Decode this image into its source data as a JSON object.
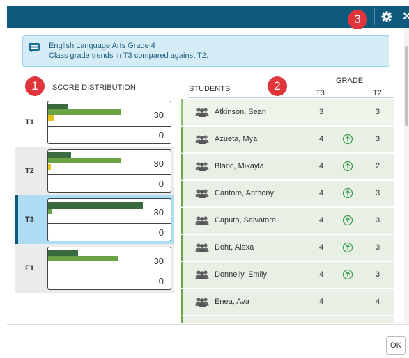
{
  "callouts": [
    "1",
    "2",
    "3"
  ],
  "info": {
    "line1": "English Language Arts Grade 4",
    "line2": "Class grade trends in T3 compared against T2."
  },
  "score_distribution": {
    "header": "SCORE DISTRIBUTION",
    "terms": [
      {
        "label": "T1",
        "top_count": "30",
        "bottom_count": "0",
        "bars": {
          "dark_fraction": 0.27,
          "green_fraction": 0.98,
          "yellow_fraction": 0.08
        }
      },
      {
        "label": "T2",
        "top_count": "30",
        "bottom_count": "0",
        "bars": {
          "dark_fraction": 0.32,
          "green_fraction": 1.0,
          "yellow_fraction": 0.04
        }
      },
      {
        "label": "T3",
        "top_count": "30",
        "bottom_count": "0",
        "selected": true,
        "bars": {
          "green_fraction": 1.0,
          "dark_fraction": 0.04
        }
      },
      {
        "label": "F1",
        "top_count": "30",
        "bottom_count": "0",
        "bars": {
          "dark_fraction": 0.43,
          "green_fraction": 1.0
        }
      }
    ]
  },
  "students": {
    "header": "STUDENTS",
    "grade_header": "GRADE",
    "col_t3": "T3",
    "col_t2": "T2",
    "rows": [
      {
        "name": "Atkinson, Sean",
        "t3": "3",
        "t2": "3",
        "trend": ""
      },
      {
        "name": "Azueta, Mya",
        "t3": "4",
        "t2": "3",
        "trend": "up"
      },
      {
        "name": "Blanc, Mikayla",
        "t3": "4",
        "t2": "2",
        "trend": "up"
      },
      {
        "name": "Cantore, Anthony",
        "t3": "4",
        "t2": "3",
        "trend": "up"
      },
      {
        "name": "Caputo, Salvatore",
        "t3": "4",
        "t2": "3",
        "trend": "up"
      },
      {
        "name": "Doht, Alexa",
        "t3": "4",
        "t2": "3",
        "trend": "up"
      },
      {
        "name": "Donnelly, Emily",
        "t3": "4",
        "t2": "3",
        "trend": "up"
      },
      {
        "name": "Enea, Ava",
        "t3": "4",
        "t2": "4",
        "trend": ""
      },
      {
        "name": "",
        "t3": "",
        "t2": "",
        "trend": ""
      }
    ]
  },
  "buttons": {
    "ok": "OK"
  },
  "icons": {
    "settings": "gear-icon",
    "close": "close-icon",
    "info": "comment-icon",
    "student": "group-icon",
    "trend": "arrow-up-circle-icon"
  },
  "colors": {
    "header_bar": "#0e5a7d",
    "callout": "#e0353b",
    "selected_term": "#aedcf3",
    "bar_dark_green": "#3a6b3e",
    "bar_green": "#6aa447",
    "bar_yellow": "#e7c11c",
    "info_bg": "#d5ecf7"
  }
}
